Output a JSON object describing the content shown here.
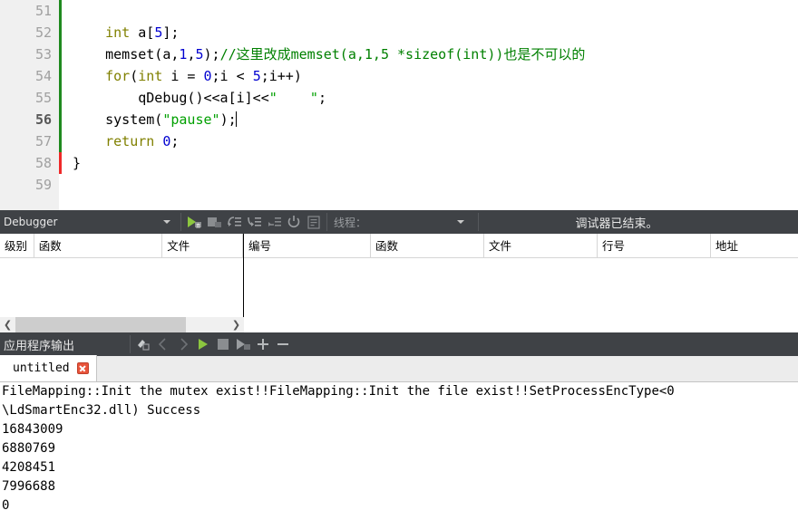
{
  "editor": {
    "lines": [
      {
        "number": "51",
        "tokens": []
      },
      {
        "number": "52",
        "tokens": [
          {
            "t": "    ",
            "c": "plain"
          },
          {
            "t": "int",
            "c": "kw"
          },
          {
            "t": " a[",
            "c": "plain"
          },
          {
            "t": "5",
            "c": "num"
          },
          {
            "t": "];",
            "c": "plain"
          }
        ]
      },
      {
        "number": "53",
        "tokens": [
          {
            "t": "    memset(a,",
            "c": "plain"
          },
          {
            "t": "1",
            "c": "num"
          },
          {
            "t": ",",
            "c": "plain"
          },
          {
            "t": "5",
            "c": "num"
          },
          {
            "t": ");",
            "c": "plain"
          },
          {
            "t": "//这里改成memset(a,1,5 *sizeof(int))也是不可以的",
            "c": "comment"
          }
        ]
      },
      {
        "number": "54",
        "tokens": [
          {
            "t": "    ",
            "c": "plain"
          },
          {
            "t": "for",
            "c": "kw"
          },
          {
            "t": "(",
            "c": "plain"
          },
          {
            "t": "int",
            "c": "kw"
          },
          {
            "t": " i = ",
            "c": "plain"
          },
          {
            "t": "0",
            "c": "num"
          },
          {
            "t": ";i < ",
            "c": "plain"
          },
          {
            "t": "5",
            "c": "num"
          },
          {
            "t": ";i++)",
            "c": "plain"
          }
        ]
      },
      {
        "number": "55",
        "tokens": [
          {
            "t": "        qDebug()<<a[i]<<",
            "c": "plain"
          },
          {
            "t": "\"    \"",
            "c": "str"
          },
          {
            "t": ";",
            "c": "plain"
          }
        ]
      },
      {
        "number": "56",
        "current": true,
        "caret": true,
        "tokens": [
          {
            "t": "    system(",
            "c": "plain"
          },
          {
            "t": "\"pause\"",
            "c": "str"
          },
          {
            "t": ");",
            "c": "plain"
          }
        ]
      },
      {
        "number": "57",
        "tokens": [
          {
            "t": "    ",
            "c": "plain"
          },
          {
            "t": "return",
            "c": "kw"
          },
          {
            "t": " ",
            "c": "plain"
          },
          {
            "t": "0",
            "c": "num"
          },
          {
            "t": ";",
            "c": "plain"
          }
        ]
      },
      {
        "number": "58",
        "tokens": [
          {
            "t": "}",
            "c": "plain"
          }
        ]
      },
      {
        "number": "59",
        "tokens": []
      }
    ]
  },
  "debugger_toolbar": {
    "selector_label": "Debugger",
    "thread_label": "线程：",
    "status": "调试器已结束。",
    "buttons": [
      {
        "name": "continue-debug-button",
        "icon": "play-debug-icon"
      },
      {
        "name": "stop-debug-button",
        "icon": "stop-debug-icon"
      },
      {
        "name": "step-over-button",
        "icon": "step-over-icon"
      },
      {
        "name": "step-into-button",
        "icon": "step-into-icon"
      },
      {
        "name": "step-out-button",
        "icon": "step-out-icon"
      },
      {
        "name": "restart-debug-button",
        "icon": "restart-icon"
      },
      {
        "name": "instruction-view-button",
        "icon": "list-icon"
      }
    ]
  },
  "issues_view": {
    "headers": [
      "级别",
      "函数",
      "文件"
    ],
    "rows": []
  },
  "stack_view": {
    "headers": [
      "编号",
      "函数",
      "文件",
      "行号",
      "地址"
    ],
    "rows": []
  },
  "output_toolbar": {
    "title": "应用程序输出",
    "buttons": [
      {
        "name": "clear-output-button",
        "icon": "broom-icon"
      },
      {
        "name": "prev-item-button",
        "icon": "chevron-left-icon"
      },
      {
        "name": "next-item-button",
        "icon": "chevron-right-icon"
      },
      {
        "name": "run-button",
        "icon": "play-icon"
      },
      {
        "name": "stop-button",
        "icon": "stop-icon"
      },
      {
        "name": "debug-button",
        "icon": "play-debug-icon"
      },
      {
        "name": "zoom-in-button",
        "icon": "plus-icon"
      },
      {
        "name": "zoom-out-button",
        "icon": "minus-icon"
      }
    ]
  },
  "output_tabs": [
    {
      "label": "untitled",
      "active": true
    }
  ],
  "output_text": [
    "FileMapping::Init the mutex exist!!FileMapping::Init the file exist!!SetProcessEncType<0",
    "\\LdSmartEnc32.dll) Success",
    "16843009",
    "6880769",
    "4208451",
    "7996688",
    "0"
  ]
}
